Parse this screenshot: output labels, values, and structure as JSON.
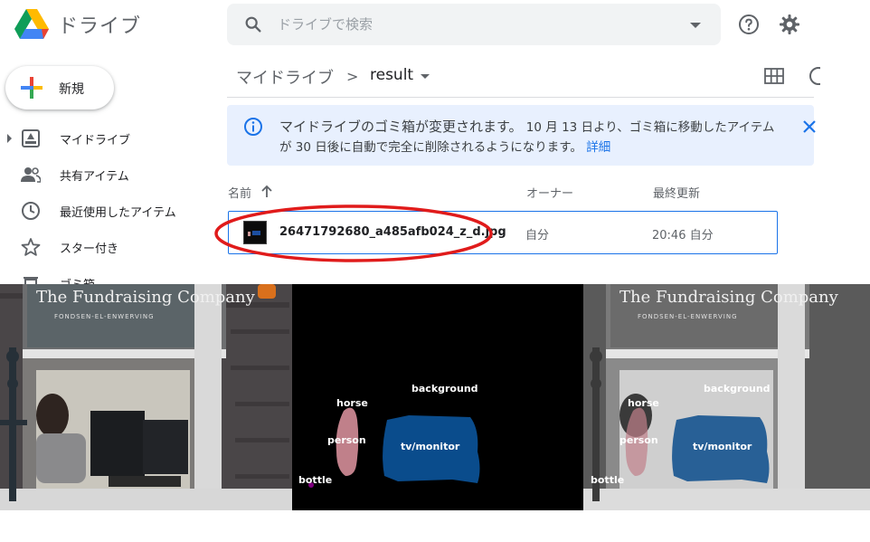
{
  "app": {
    "title": "ドライブ",
    "logo_icon": "google-drive-logo"
  },
  "search": {
    "placeholder": "ドライブで検索",
    "icon": "search-icon",
    "options_icon": "caret-down-icon"
  },
  "header_icons": {
    "help": "help-icon",
    "settings": "gear-icon"
  },
  "new_button": {
    "label": "新規"
  },
  "sidebar": {
    "items": [
      {
        "label": "マイドライブ",
        "icon": "my-drive-icon"
      },
      {
        "label": "共有アイテム",
        "icon": "shared-people-icon"
      },
      {
        "label": "最近使用したアイテム",
        "icon": "clock-icon"
      },
      {
        "label": "スター付き",
        "icon": "star-icon"
      },
      {
        "label": "ゴミ箱",
        "icon": "trash-icon"
      }
    ]
  },
  "breadcrumb": {
    "root": "マイドライブ",
    "separator": ">",
    "current": "result"
  },
  "view_icons": {
    "grid": "grid-view-icon",
    "details": "info-icon"
  },
  "banner": {
    "headline": "マイドライブのゴミ箱が変更されます。",
    "body": " 10 月 13 日より、ゴミ箱に移動したアイテムが 30 日後に自動で完全に削除されるようになります。 ",
    "link": "詳細",
    "icon": "info-icon",
    "close_icon": "close-icon"
  },
  "file_list": {
    "columns": {
      "name": "名前",
      "owner": "オーナー",
      "modified": "最終更新"
    },
    "sort_icon": "arrow-up-icon",
    "rows": [
      {
        "name": "26471792680_a485afb024_z_d.jpg",
        "owner": "自分",
        "modified": "20:46 自分"
      }
    ]
  },
  "image_preview": {
    "sign_text": "The Fundraising Company",
    "sign_subtext": "FONDSEN-EL-ENWERVING",
    "segmentation_labels": [
      "horse",
      "background",
      "person",
      "tv/monitor",
      "bottle"
    ],
    "colors": {
      "horse": "#c0808a",
      "person": "#c08080",
      "tv_monitor": "#0a4c8c",
      "bottle": "#80007f"
    }
  },
  "colors": {
    "accent": "#1a73e8",
    "banner_bg": "#e8f0fe",
    "annotation_red": "#e01b1b"
  }
}
